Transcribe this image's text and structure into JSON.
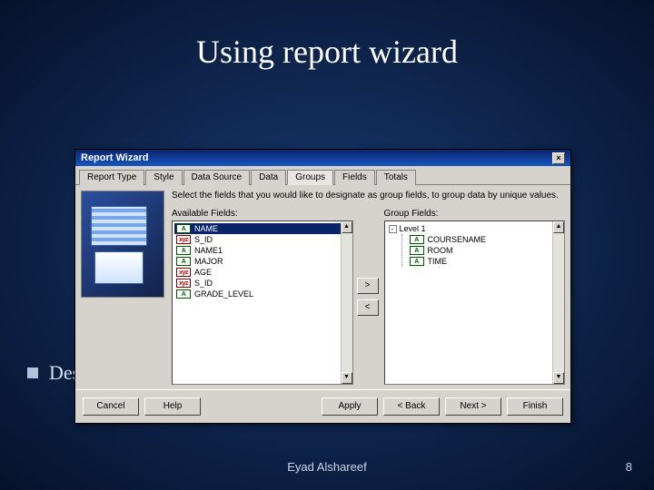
{
  "slide": {
    "title": "Using report wizard",
    "bullet_text": "Des",
    "footer_author": "Eyad Alshareef",
    "page_number": "8"
  },
  "wizard": {
    "title": "Report Wizard",
    "close_glyph": "×",
    "tabs": [
      "Report Type",
      "Style",
      "Data Source",
      "Data",
      "Groups",
      "Fields",
      "Totals"
    ],
    "active_tab_index": 4,
    "instructions": "Select the fields that you would like to designate as group fields, to group data by unique values.",
    "available_label": "Available Fields:",
    "group_label": "Group Fields:",
    "available_fields": [
      {
        "ico": "A",
        "text": "NAME",
        "selected": true
      },
      {
        "ico": "xyz",
        "text": "S_ID"
      },
      {
        "ico": "A",
        "text": "NAME1"
      },
      {
        "ico": "A",
        "text": "MAJOR"
      },
      {
        "ico": "xyz",
        "text": "AGE"
      },
      {
        "ico": "xyz",
        "text": "S_ID"
      },
      {
        "ico": "A",
        "text": "GRADE_LEVEL"
      }
    ],
    "group_tree": {
      "root": "Level 1",
      "children": [
        {
          "ico": "A",
          "text": "COURSENAME"
        },
        {
          "ico": "A",
          "text": "ROOM"
        },
        {
          "ico": "A",
          "text": "TIME"
        }
      ]
    },
    "move_right": ">",
    "move_left": "<",
    "buttons": {
      "cancel": "Cancel",
      "help": "Help",
      "apply": "Apply",
      "back": "< Back",
      "next": "Next >",
      "finish": "Finish"
    }
  }
}
